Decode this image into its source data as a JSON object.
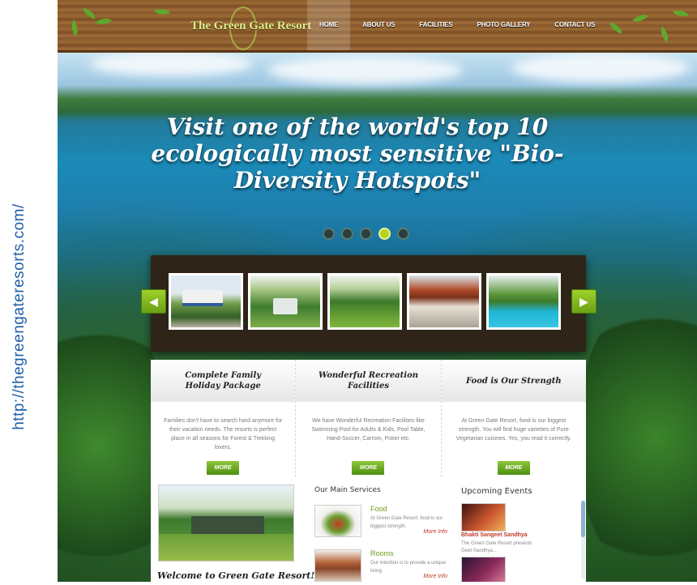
{
  "caption": {
    "url": "http://thegreengateresorts.com/"
  },
  "header": {
    "logo": "The Green Gate Resort",
    "nav": [
      "HOME",
      "ABOUT US",
      "FACILITIES",
      "PHOTO GALLERY",
      "CONTACT US"
    ],
    "active_nav": "HOME"
  },
  "hero": {
    "title": "Visit one of the world's top 10 ecologically most sensitive \"Bio-Diversity Hotspots\"",
    "slide_dots": 5,
    "active_slide": 4
  },
  "gallery": {
    "thumbnails": [
      "resort-entrance",
      "garden-fountain",
      "lawn-and-palms",
      "pavilion",
      "swimming-pool"
    ],
    "prev_icon": "arrow-left-icon",
    "next_icon": "arrow-right-icon"
  },
  "features": [
    {
      "title": "Complete Family Holiday Package",
      "text": "Families don't have to search hard anymore for their vacation needs. The resorts is perfect place in all seasons for Forest & Trekking lovers.",
      "button": "MORE"
    },
    {
      "title": "Wonderful Recreation Facilities",
      "text": "We have Wonderful Recreation Facilities like Swimming Pool for Adults & Kids, Pool Table, Hand-Soccer, Carrom, Poker etc.",
      "button": "MORE"
    },
    {
      "title": "Food is Our Strength",
      "text": "At Green Gate Resort, food is our biggest strength. You will find huge varieties of Pure Vegetarian cuisines. Yes, you read it correctly.",
      "button": "MORE"
    }
  ],
  "welcome": {
    "title": "Welcome to Green Gate Resort!"
  },
  "services": {
    "title": "Our Main Services",
    "items": [
      {
        "name": "Food",
        "text": "At Green Gate Resort, food is our biggest strength.",
        "more": "More Info"
      },
      {
        "name": "Rooms",
        "text": "Our intention is to provide a unique living.",
        "more": "More Info"
      }
    ]
  },
  "events": {
    "title": "Upcoming Events",
    "items": [
      {
        "name": "Bhakti Sangeet Sandhya",
        "text": "The Green Gate Resort presents Geet-Sandhya..."
      }
    ]
  },
  "colors": {
    "accent_green": "#8cc739",
    "nav_wood": "#8a5a2c",
    "link_red": "#c0392b",
    "url_blue": "#1f5fa8"
  }
}
